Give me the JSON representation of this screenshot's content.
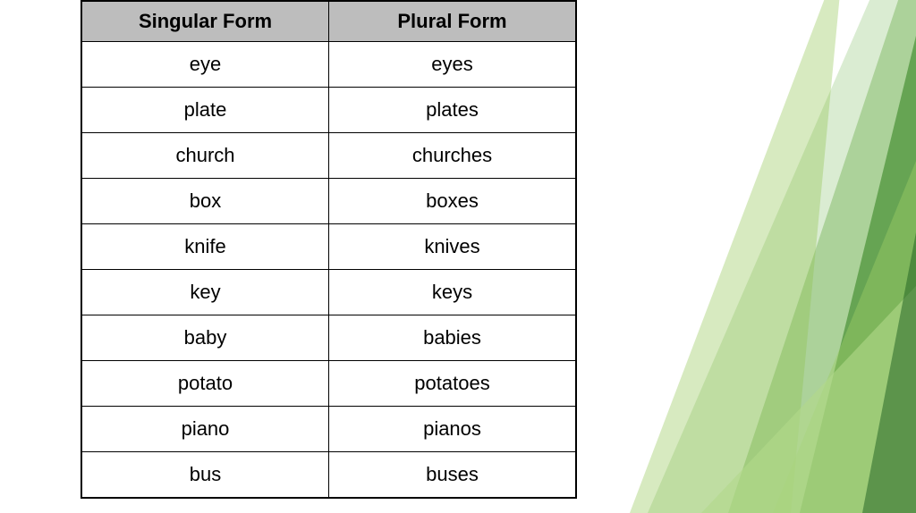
{
  "table": {
    "headers": {
      "singular": "Singular Form",
      "plural": "Plural Form"
    },
    "rows": [
      {
        "singular": "eye",
        "plural": "eyes"
      },
      {
        "singular": "plate",
        "plural": "plates"
      },
      {
        "singular": "church",
        "plural": "churches"
      },
      {
        "singular": "box",
        "plural": "boxes"
      },
      {
        "singular": "knife",
        "plural": "knives"
      },
      {
        "singular": "key",
        "plural": "keys"
      },
      {
        "singular": "baby",
        "plural": "babies"
      },
      {
        "singular": "potato",
        "plural": "potatoes"
      },
      {
        "singular": "piano",
        "plural": "pianos"
      },
      {
        "singular": "bus",
        "plural": "buses"
      }
    ]
  }
}
